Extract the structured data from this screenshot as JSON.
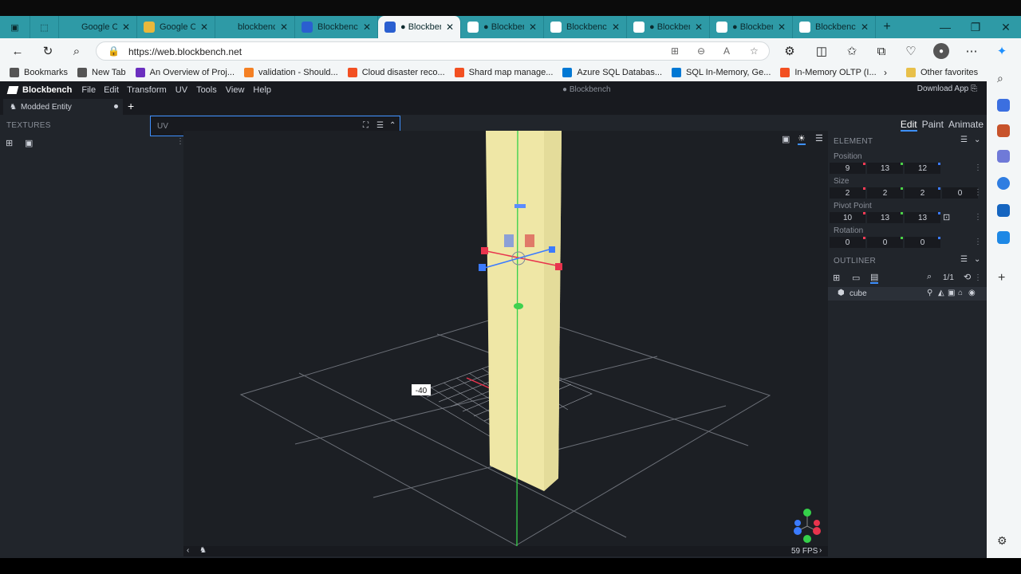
{
  "browser": {
    "tabs": [
      {
        "title": "Google Ch",
        "color": "#2e9aa6",
        "active": false
      },
      {
        "title": "Google Ch",
        "color": "#e9b83b",
        "active": false
      },
      {
        "title": "blockbenc",
        "color": "#2e9aa6",
        "active": false
      },
      {
        "title": "Blockbenc",
        "color": "#2a5fd0",
        "active": false
      },
      {
        "title": "● Blockben",
        "color": "#2a5fd0",
        "active": true
      },
      {
        "title": "● Blockben",
        "color": "#ffffff",
        "active": false
      },
      {
        "title": "Blockbenc",
        "color": "#ffffff",
        "active": false
      },
      {
        "title": "● Blockben",
        "color": "#ffffff",
        "active": false
      },
      {
        "title": "● Blockben",
        "color": "#ffffff",
        "active": false
      },
      {
        "title": "Blockbenc",
        "color": "#ffffff",
        "active": false
      }
    ],
    "url": "https://web.blockbench.net",
    "bookmarks": [
      {
        "label": "Bookmarks",
        "color": "#555"
      },
      {
        "label": "New Tab",
        "color": "#555"
      },
      {
        "label": "An Overview of Proj...",
        "color": "#6b2fbf"
      },
      {
        "label": "validation - Should...",
        "color": "#f48024"
      },
      {
        "label": "Cloud disaster reco...",
        "color": "#f25022"
      },
      {
        "label": "Shard map manage...",
        "color": "#f25022"
      },
      {
        "label": "Azure SQL Databas...",
        "color": "#0078d4"
      },
      {
        "label": "SQL In-Memory, Ge...",
        "color": "#0078d4"
      },
      {
        "label": "In-Memory OLTP (I...",
        "color": "#f25022"
      }
    ],
    "other_favorites": "Other favorites"
  },
  "app": {
    "brand": "Blockbench",
    "menus": [
      "File",
      "Edit",
      "Transform",
      "UV",
      "Tools",
      "View",
      "Help"
    ],
    "center_title": "● Blockbench",
    "download": "Download App",
    "project_tab": "Modded Entity",
    "textures_title": "TEXTURES",
    "uv_title": "UV",
    "modes": [
      "Edit",
      "Paint",
      "Animate"
    ],
    "element_title": "ELEMENT",
    "position_label": "Position",
    "position": [
      "9",
      "13",
      "12"
    ],
    "size_label": "Size",
    "size": [
      "2",
      "2",
      "2",
      "0"
    ],
    "pivot_label": "Pivot Point",
    "pivot": [
      "10",
      "13",
      "13"
    ],
    "rotation_label": "Rotation",
    "rotation": [
      "0",
      "0",
      "0"
    ],
    "outliner_title": "OUTLINER",
    "outliner_count": "1/1",
    "cube_name": "cube",
    "grid_label": "-40",
    "fps": "59 FPS"
  },
  "colors": {
    "tabstrip": "#2e9aa6",
    "accent": "#3e90ff",
    "cube": "#efe7a6"
  }
}
